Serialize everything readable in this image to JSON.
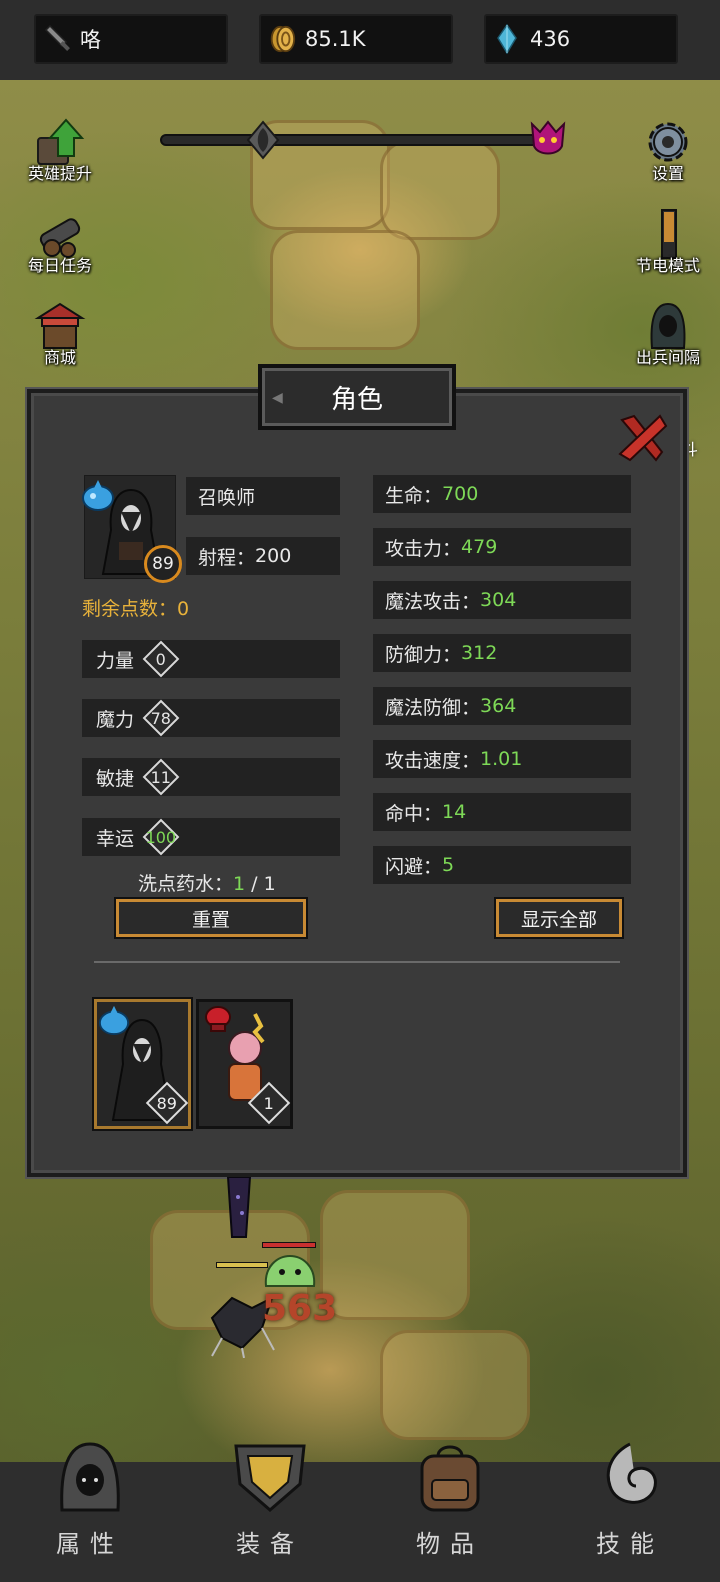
{
  "topbar": {
    "player_name": "咯",
    "gold": "85.1K",
    "gems": "436"
  },
  "left_menu": [
    {
      "label": "英雄提升",
      "icon": "upgrade-arrow-icon"
    },
    {
      "label": "每日任务",
      "icon": "cannon-icon"
    },
    {
      "label": "商城",
      "icon": "shop-stall-icon"
    }
  ],
  "right_menu": [
    {
      "label": "设置",
      "icon": "gear-icon"
    },
    {
      "label": "节电模式",
      "icon": "battery-icon"
    },
    {
      "label": "出兵间隔",
      "icon": "hooded-figure-icon"
    },
    {
      "label": "斗",
      "icon": "partial-icon"
    }
  ],
  "wave_progress": {
    "value": 0.27
  },
  "dialog": {
    "title": "角色",
    "hero": {
      "class": "召唤师",
      "range_label": "射程：",
      "range_value": "200",
      "level": "89"
    },
    "remaining_points_label": "剩余点数：",
    "remaining_points_value": "0",
    "attributes": [
      {
        "label": "力量",
        "value": "0"
      },
      {
        "label": "魔力",
        "value": "78"
      },
      {
        "label": "敏捷",
        "value": "11"
      },
      {
        "label": "幸运",
        "value": "100"
      }
    ],
    "stats": [
      {
        "label": "生命：",
        "value": "700"
      },
      {
        "label": "攻击力：",
        "value": "479"
      },
      {
        "label": "魔法攻击：",
        "value": "304"
      },
      {
        "label": "防御力：",
        "value": "312"
      },
      {
        "label": "魔法防御：",
        "value": "364"
      },
      {
        "label": "攻击速度：",
        "value": "1.01"
      },
      {
        "label": "命中：",
        "value": "14"
      },
      {
        "label": "闪避：",
        "value": "5"
      }
    ],
    "potion_label": "洗点药水：",
    "potion_current": "1",
    "potion_sep": " / ",
    "potion_max": "1",
    "reset_button": "重置",
    "show_all_button": "显示全部",
    "hero_cards": [
      {
        "level": "89",
        "badge": "water-drop-icon"
      },
      {
        "level": "1",
        "badge": "boxing-glove-icon"
      }
    ]
  },
  "battle": {
    "damage_number": "563"
  },
  "bottom_nav": [
    {
      "label": "属性",
      "icon": "hood-icon"
    },
    {
      "label": "装备",
      "icon": "shield-icon"
    },
    {
      "label": "物品",
      "icon": "backpack-icon"
    },
    {
      "label": "技能",
      "icon": "swirl-icon"
    }
  ],
  "colors": {
    "stat_value": "#7ed957",
    "points_label": "#e8b23a",
    "button_border": "#c88a34",
    "level_ring": "#d98a1e"
  }
}
